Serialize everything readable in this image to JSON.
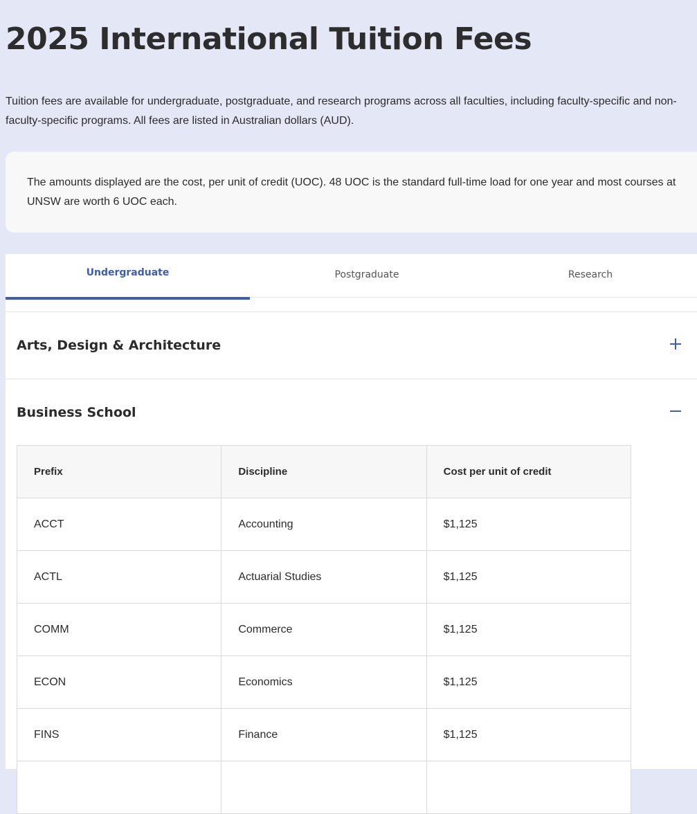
{
  "page": {
    "title": "2025 International Tuition Fees",
    "intro": "Tuition fees are available for undergraduate, postgraduate, and research programs across all faculties, including faculty-specific and non-faculty-specific programs. All fees are listed in Australian dollars (AUD).",
    "info_box": "The amounts displayed are the cost, per unit of credit (UOC). 48 UOC is the standard full-time load for one year and most courses at UNSW are worth 6 UOC each."
  },
  "tabs": [
    {
      "label": "Undergraduate",
      "active": true
    },
    {
      "label": "Postgraduate",
      "active": false
    },
    {
      "label": "Research",
      "active": false
    }
  ],
  "accordion": [
    {
      "title": "Arts, Design & Architecture",
      "state": "collapsed",
      "icon": "plus-icon"
    },
    {
      "title": "Business School",
      "state": "expanded",
      "icon": "minus-icon"
    }
  ],
  "table": {
    "headers": [
      "Prefix",
      "Discipline",
      "Cost per unit of credit"
    ],
    "rows": [
      [
        "ACCT",
        "Accounting",
        "$1,125"
      ],
      [
        "ACTL",
        "Actuarial Studies",
        "$1,125"
      ],
      [
        "COMM",
        "Commerce",
        "$1,125"
      ],
      [
        "ECON",
        "Economics",
        "$1,125"
      ],
      [
        "FINS",
        "Finance",
        "$1,125"
      ],
      [
        "",
        "",
        ""
      ]
    ]
  },
  "colors": {
    "page_background": "#e3e7f6",
    "accent": "#3c5db0",
    "text": "#2b2b2b"
  }
}
